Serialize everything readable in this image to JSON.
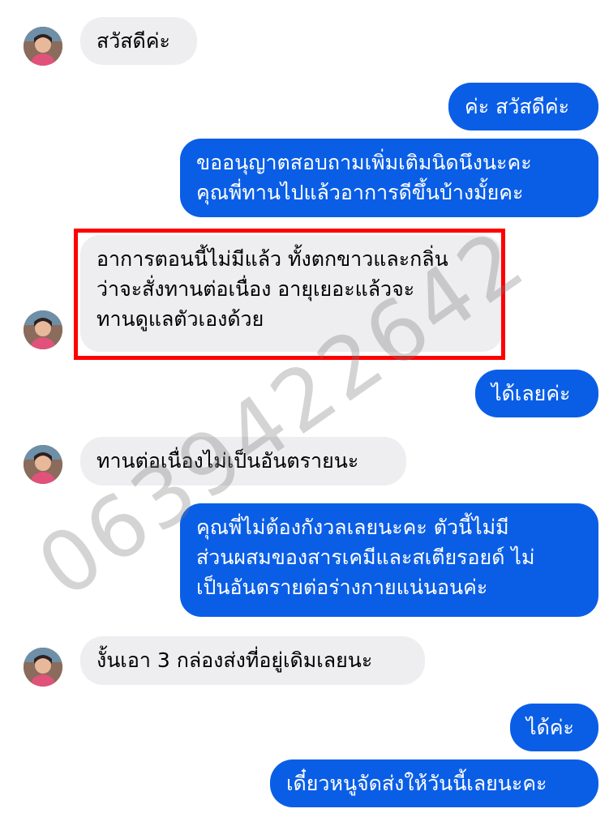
{
  "messages": [
    {
      "text": "สวัสดีค่ะ"
    },
    {
      "text": "ค่ะ สวัสดีค่ะ"
    },
    {
      "text": "ขออนุญาตสอบถามเพิ่มเติมนิดนึงนะคะ\nคุณพี่ทานไปแล้วอาการดีขึ้นบ้างมั้ยคะ"
    },
    {
      "text": "อาการตอนนี้ไม่มีแล้ว ทั้งตกขาวและกลิ่น\nว่าจะสั่งทานต่อเนื่อง อายุเยอะแล้วจะ\nทานดูแลตัวเองด้วย"
    },
    {
      "text": "ได้เลยค่ะ"
    },
    {
      "text": "ทานต่อเนื่องไม่เป็นอันตรายนะ"
    },
    {
      "text": "คุณพี่ไม่ต้องกังวลเลยนะคะ ตัวนี้ไม่มี\nส่วนผสมของสารเคมีและสเตียรอยด์ ไม่\nเป็นอันตรายต่อร่างกายแน่นอนค่ะ"
    },
    {
      "text": "งั้นเอา 3 กล่องส่งที่อยู่เดิมเลยนะ"
    },
    {
      "text": "ได้ค่ะ"
    },
    {
      "text": "เดี๋ยวหนูจัดส่งให้วันนี้เลยนะคะ"
    }
  ],
  "watermark": "0639422642",
  "colors": {
    "outgoing": "#0a5ee6",
    "incoming": "#eeeef1",
    "highlight": "#ff0000"
  }
}
